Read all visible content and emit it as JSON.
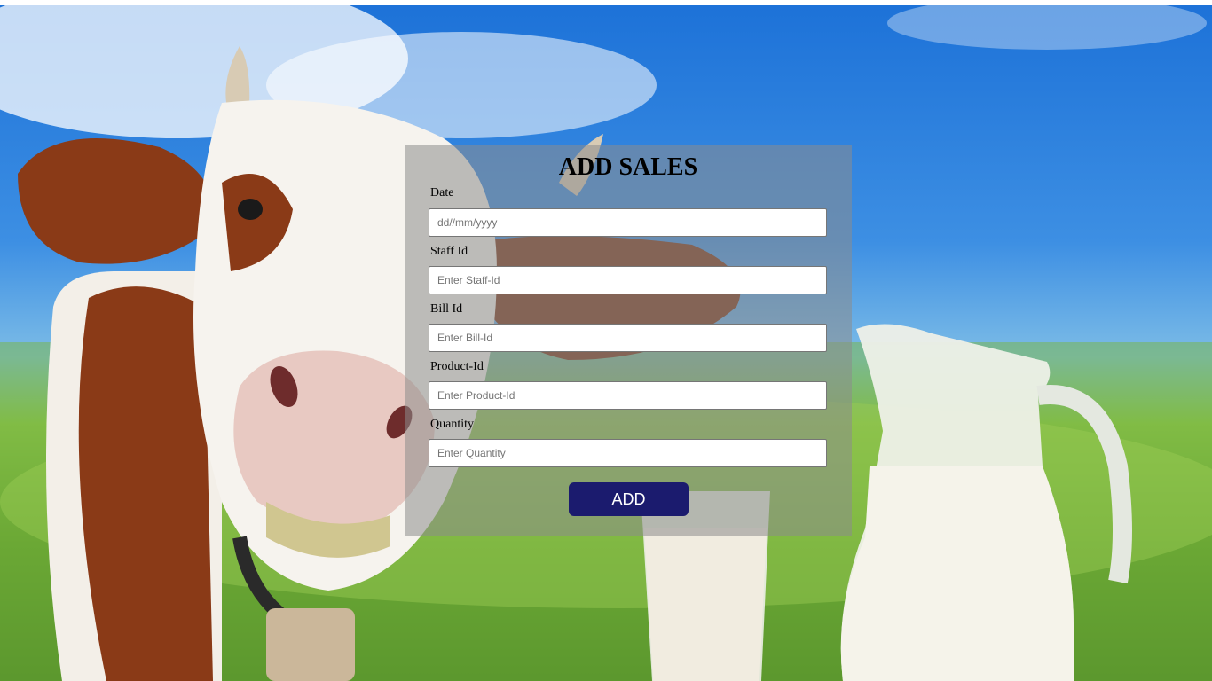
{
  "form": {
    "title": "ADD SALES",
    "fields": [
      {
        "label": "Date",
        "placeholder": "dd//mm/yyyy"
      },
      {
        "label": "Staff Id",
        "placeholder": "Enter Staff-Id"
      },
      {
        "label": "Bill Id",
        "placeholder": "Enter Bill-Id"
      },
      {
        "label": "Product-Id",
        "placeholder": "Enter Product-Id"
      },
      {
        "label": "Quantity",
        "placeholder": "Enter Quantity"
      }
    ],
    "submit_label": "ADD"
  },
  "colors": {
    "button": "#1b1b6e",
    "panel": "rgba(140,140,140,0.55)",
    "sky": "#1d72d8",
    "grass": "#88c24a"
  }
}
